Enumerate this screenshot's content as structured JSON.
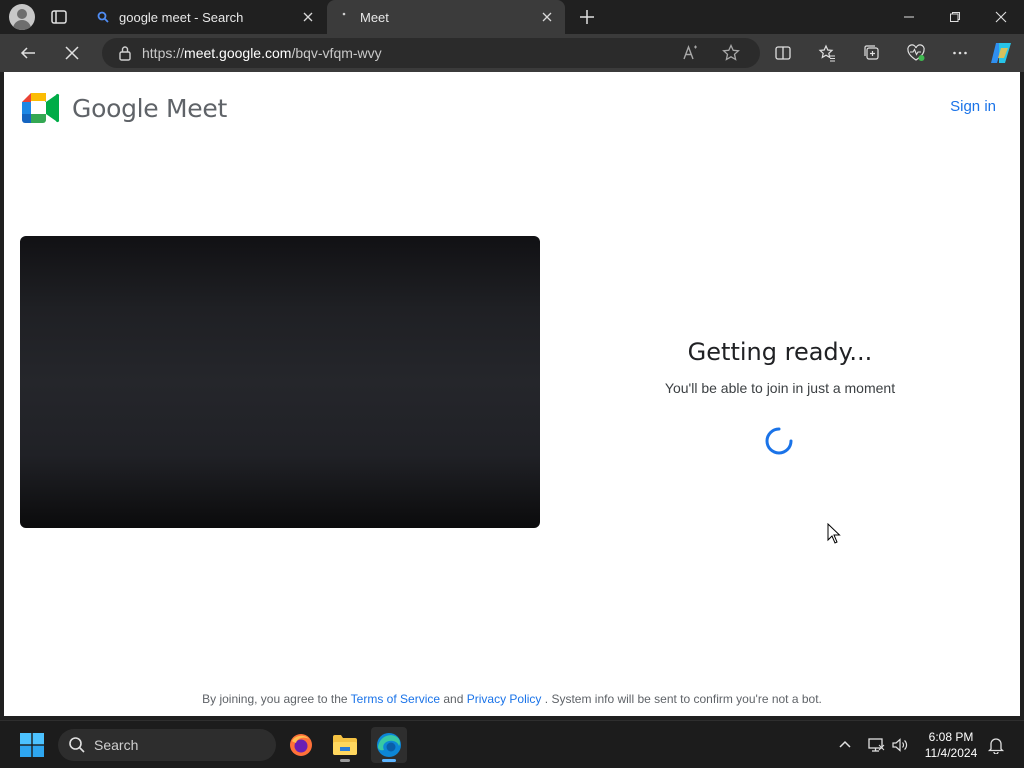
{
  "browser": {
    "tabs": [
      {
        "title": "google meet - Search",
        "favicon": "search-favicon"
      },
      {
        "title": "Meet",
        "favicon": "loading-dot"
      }
    ],
    "address": {
      "scheme": "https://",
      "host": "meet.google.com",
      "path": "/bqv-vfqm-wvy"
    }
  },
  "page": {
    "brand": "Google Meet",
    "signin": "Sign in",
    "ready_heading": "Getting ready...",
    "ready_sub": "You'll be able to join in just a moment",
    "footer": {
      "prefix": "By joining, you agree to the",
      "terms": "Terms of Service",
      "and": "and",
      "privacy": "Privacy Policy",
      "suffix": ". System info will be sent to confirm you're not a bot."
    }
  },
  "taskbar": {
    "search_label": "Search",
    "time": "6:08 PM",
    "date": "11/4/2024"
  },
  "colors": {
    "link_blue": "#1a73e8",
    "browser_dark": "#202020",
    "toolbar": "#3b3b3b"
  }
}
